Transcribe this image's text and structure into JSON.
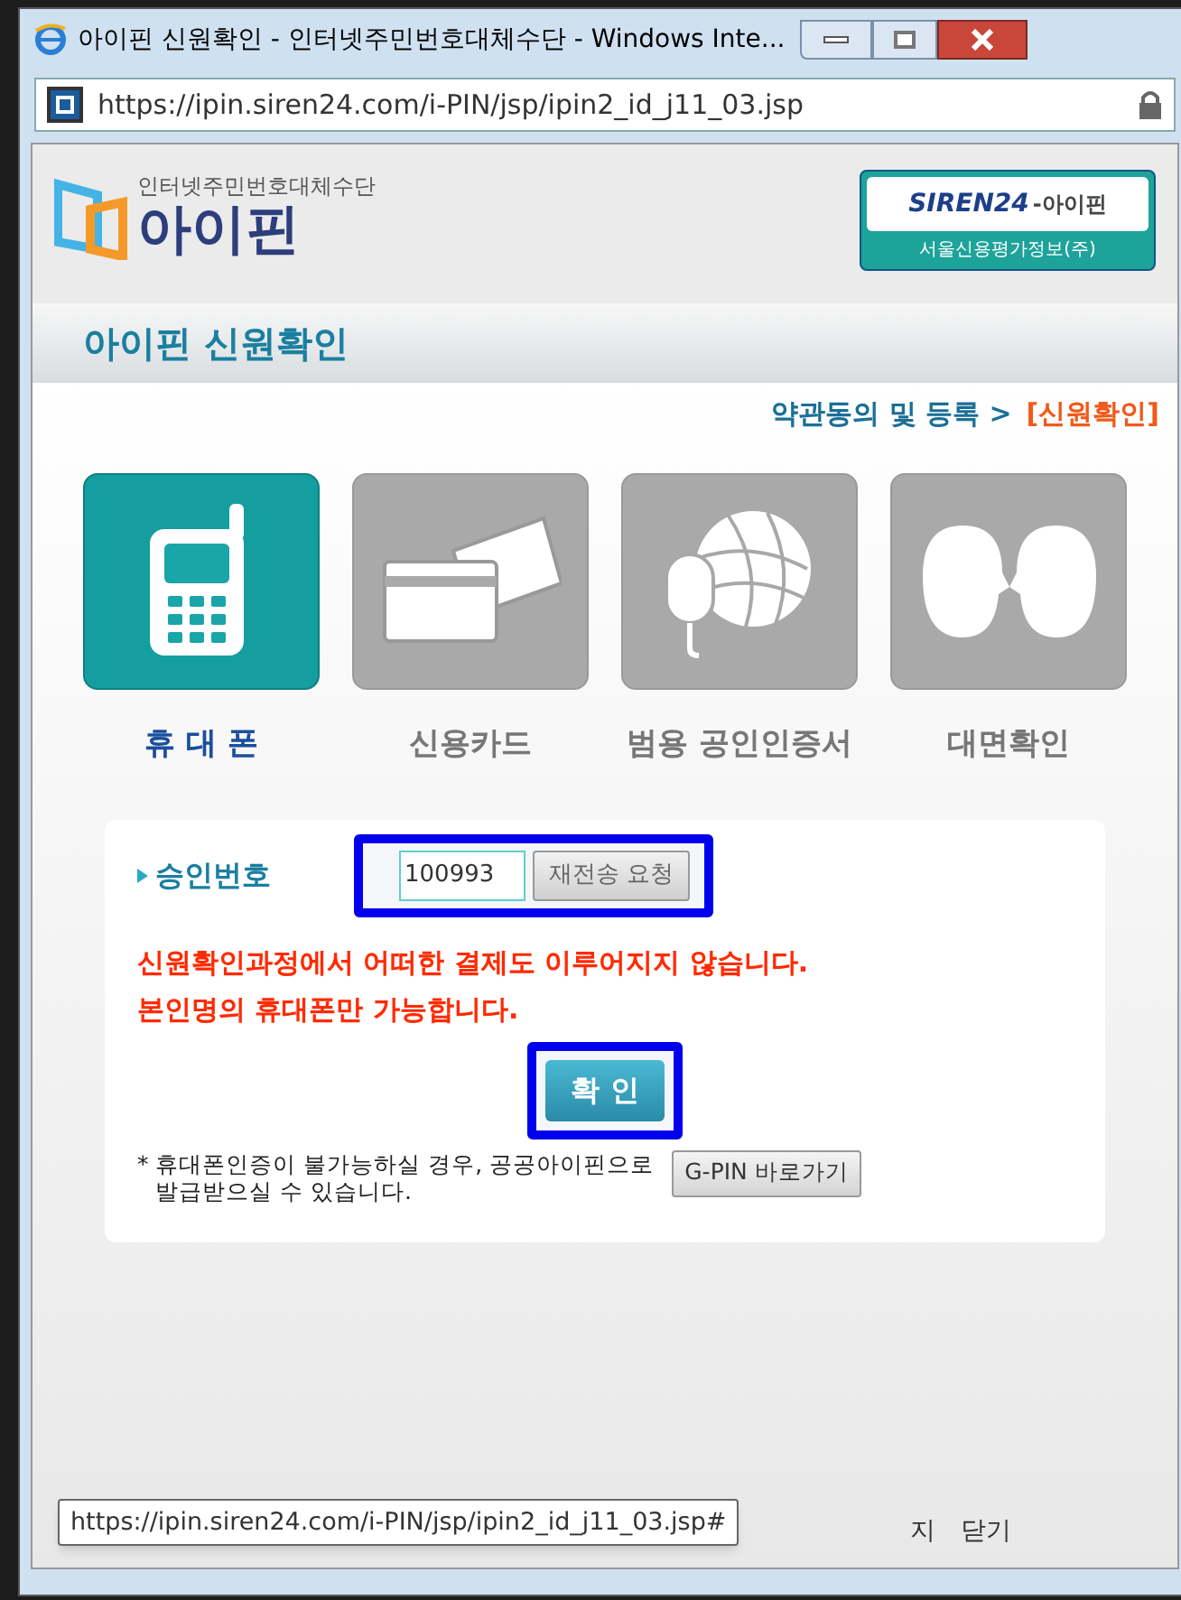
{
  "window": {
    "title": "아이핀 신원확인 - 인터넷주민번호대체수단 - Windows Inte...",
    "address": "https://ipin.siren24.com/i-PIN/jsp/ipin2_id_j11_03.jsp"
  },
  "header": {
    "logo_caption": "인터넷주민번호대체수단",
    "logo_text": "아이핀",
    "partner_brand": "SIREN24",
    "partner_suffix": "-아이핀",
    "partner_company": "서울신용평가정보(주)"
  },
  "page_title": "아이핀 신원확인",
  "breadcrumb": [
    {
      "label": "약관동의 및 등록 >",
      "selected": false
    },
    {
      "label": "[신원확인]",
      "selected": true
    }
  ],
  "methods": [
    {
      "kind": "phone",
      "label": "휴 대 폰",
      "selected": true
    },
    {
      "kind": "card",
      "label": "신용카드",
      "selected": false
    },
    {
      "kind": "certificate",
      "label": "범용 공인인증서",
      "selected": false
    },
    {
      "kind": "face",
      "label": "대면확인",
      "selected": false
    }
  ],
  "form": {
    "label": "승인번호",
    "value": "100993",
    "resend_button": "재전송 요청"
  },
  "notices": [
    "신원확인과정에서 어떠한 결제도 이루어지지 않습니다.",
    "본인명의 휴대폰만 가능합니다."
  ],
  "confirm_button": "확 인",
  "gpin_note": [
    "* 휴대폰인증이 불가능하실 경우, 공공아이핀으로",
    "발급받으실 수 있습니다."
  ],
  "gpin_button": "G-PIN 바로가기",
  "footer_links": [
    "지",
    "닫기"
  ],
  "status_tooltip": "https://ipin.siren24.com/i-PIN/jsp/ipin2_id_j11_03.jsp#"
}
